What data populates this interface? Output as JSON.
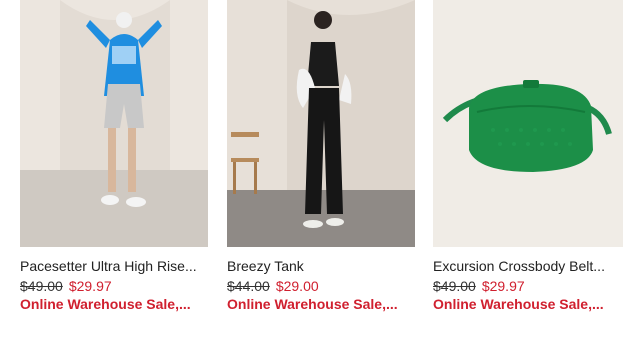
{
  "products": [
    {
      "name": "Pacesetter Ultra High Rise...",
      "original_price": "$49.00",
      "sale_price": "$29.97",
      "promo": "Online Warehouse Sale,..."
    },
    {
      "name": "Breezy Tank",
      "original_price": "$44.00",
      "sale_price": "$29.00",
      "promo": "Online Warehouse Sale,..."
    },
    {
      "name": "Excursion Crossbody Belt...",
      "original_price": "$49.00",
      "sale_price": "$29.97",
      "promo": "Online Warehouse Sale,..."
    }
  ],
  "colors": {
    "sale": "#d0202f",
    "text": "#222222"
  }
}
